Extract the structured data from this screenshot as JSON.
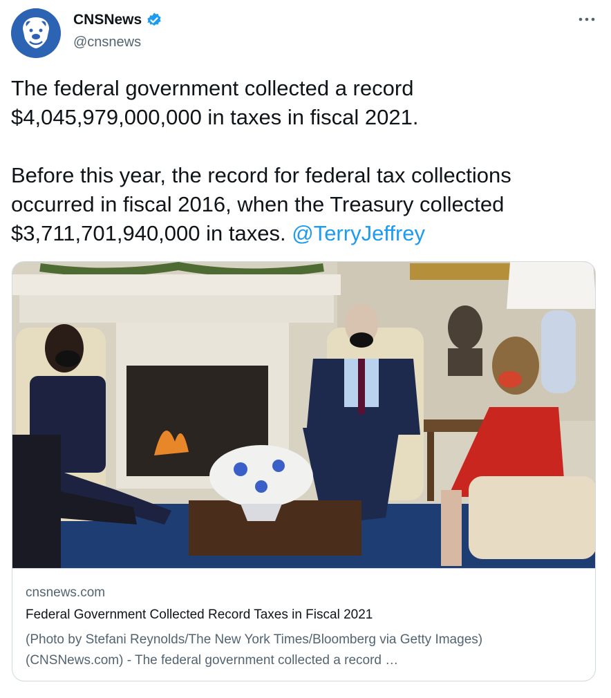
{
  "author": {
    "display_name": "CNSNews",
    "handle": "@cnsnews",
    "avatar_icon": "bulldog-logo-icon",
    "verified_icon": "verified-badge-icon",
    "brand_color": "#2d63b3"
  },
  "menu": {
    "icon": "more-options-icon"
  },
  "tweet": {
    "line1": "The federal government collected a record $4,045,979,000,000 in taxes in fiscal 2021.",
    "line2": "Before this year, the record for federal tax collections occurred in fiscal 2016, when the Treasury collected $3,711,701,940,000 in taxes.",
    "mention": "@TerryJeffrey"
  },
  "link_card": {
    "domain": "cnsnews.com",
    "title": "Federal Government Collected Record Taxes in Fiscal 2021",
    "description": "(Photo by Stefani Reynolds/The New York Times/Bloomberg via Getty Images) (CNSNews.com) - The federal government collected a record …",
    "image_icon": "oval-office-meeting-photo"
  },
  "colors": {
    "link": "#1d9bf0",
    "muted": "#536471",
    "border": "#cfd9de"
  }
}
